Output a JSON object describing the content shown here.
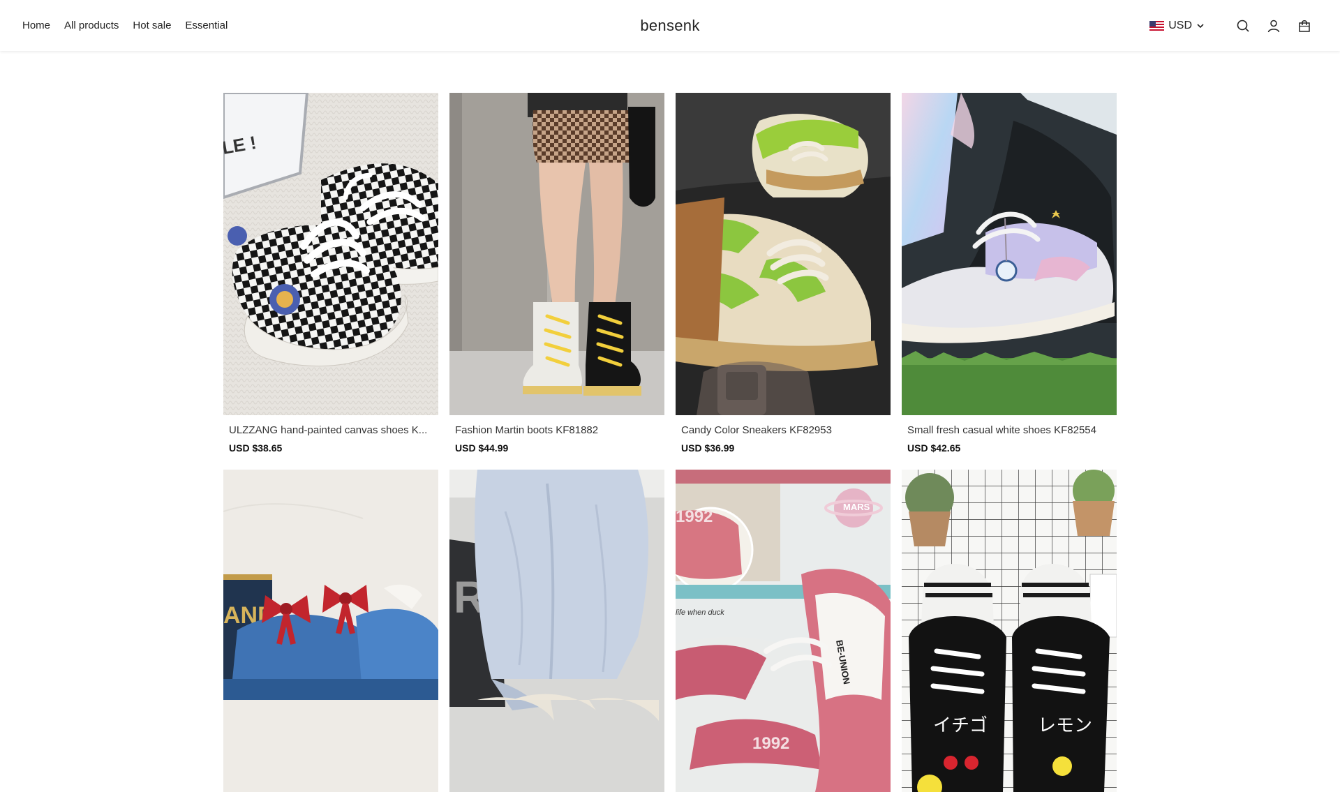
{
  "nav": {
    "links": [
      "Home",
      "All products",
      "Hot sale",
      "Essential"
    ]
  },
  "brand": "bensenk",
  "currency": {
    "selected": "USD",
    "flag_icon": "us-flag-icon"
  },
  "header_icons": [
    "search-icon",
    "account-icon",
    "cart-icon"
  ],
  "products": [
    {
      "title": "ULZZANG hand-painted canvas shoes K...",
      "price": "USD $38.65"
    },
    {
      "title": "Fashion Martin boots KF81882",
      "price": "USD $44.99"
    },
    {
      "title": "Candy Color Sneakers KF82953",
      "price": "USD $36.99"
    },
    {
      "title": "Small fresh casual white shoes KF82554",
      "price": "USD $42.65"
    },
    {
      "title": "",
      "price": ""
    },
    {
      "title": "",
      "price": ""
    },
    {
      "title": "",
      "price": ""
    },
    {
      "title": "",
      "price": ""
    }
  ],
  "image_texts": {
    "p1_sign": "LE !",
    "p5_sign": "AND",
    "p6_bag": "R",
    "p7_sticker": "MARS",
    "p7_num": "1992",
    "p7_caption": "life when duck",
    "p7_brand": "BE-UNION",
    "p8_left": "イチゴ",
    "p8_right": "レモン"
  },
  "colors": {
    "accent": "#222222",
    "header_bg": "#ffffff"
  }
}
